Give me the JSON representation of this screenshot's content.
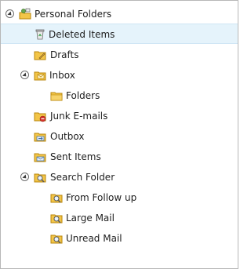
{
  "tree": {
    "root": {
      "label": "Personal Folders",
      "icon": "personal-folders-icon"
    },
    "items": [
      {
        "label": "Deleted Items",
        "icon": "recycle-bin-icon"
      },
      {
        "label": "Drafts",
        "icon": "drafts-folder-icon"
      },
      {
        "label": "Inbox",
        "icon": "inbox-folder-icon"
      },
      {
        "label": "Folders",
        "icon": "folder-icon"
      },
      {
        "label": "Junk E-mails",
        "icon": "junk-folder-icon"
      },
      {
        "label": "Outbox",
        "icon": "outbox-folder-icon"
      },
      {
        "label": "Sent Items",
        "icon": "sent-folder-icon"
      },
      {
        "label": "Search Folder",
        "icon": "search-folder-icon"
      },
      {
        "label": "From Follow up",
        "icon": "search-folder-icon"
      },
      {
        "label": "Large Mail",
        "icon": "search-folder-icon"
      },
      {
        "label": "Unread Mail",
        "icon": "search-folder-icon"
      }
    ],
    "selected": "Deleted Items"
  },
  "colors": {
    "selection_bg": "#e5f3fb",
    "folder_yellow": "#f3c548",
    "border": "#b7b7b7"
  }
}
